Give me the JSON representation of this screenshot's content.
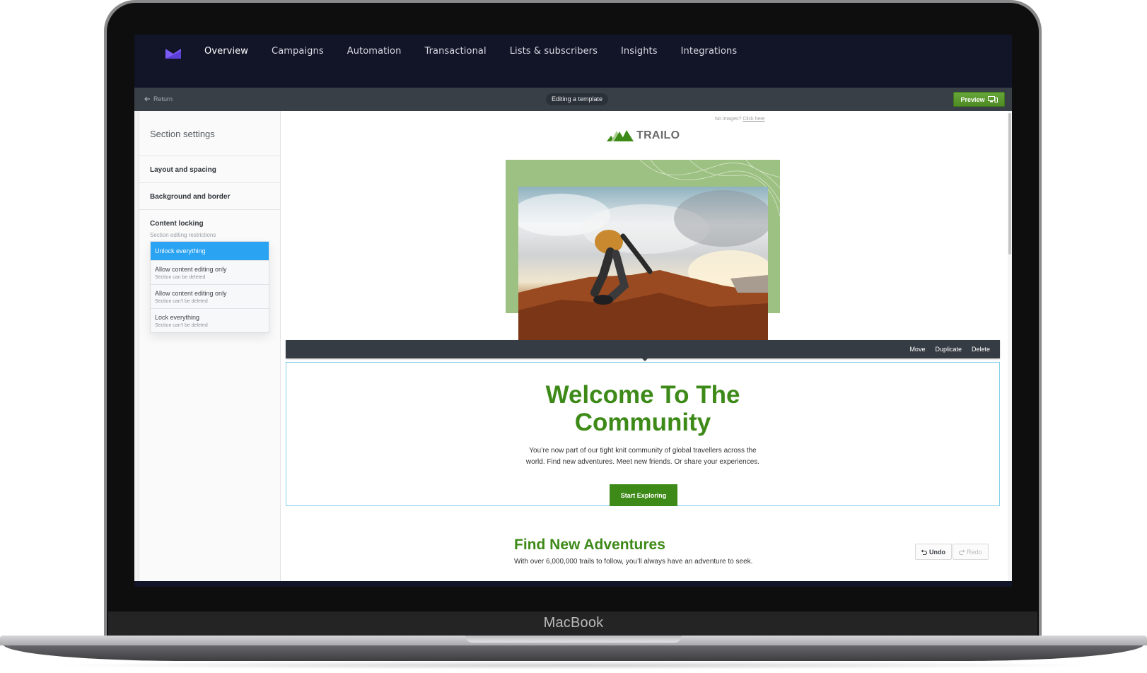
{
  "device": {
    "label": "MacBook"
  },
  "topnav": {
    "logo_icon": "envelope-logo-icon",
    "items": [
      {
        "label": "Overview",
        "active": true
      },
      {
        "label": "Campaigns",
        "active": false
      },
      {
        "label": "Automation",
        "active": false
      },
      {
        "label": "Transactional",
        "active": false
      },
      {
        "label": "Lists & subscribers",
        "active": false
      },
      {
        "label": "Insights",
        "active": false
      },
      {
        "label": "Integrations",
        "active": false
      }
    ]
  },
  "editbar": {
    "return_label": "Return",
    "return_icon": "arrow-left-icon",
    "status": "Editing a template",
    "preview_label": "Preview",
    "preview_icon": "devices-icon"
  },
  "sidebar": {
    "title": "Section settings",
    "sections": [
      {
        "label": "Layout and spacing"
      },
      {
        "label": "Background and border"
      },
      {
        "label": "Content locking"
      }
    ],
    "locking": {
      "subtitle": "Section editing restrictions",
      "options": [
        {
          "label": "Unlock everything",
          "sub": "",
          "selected": true
        },
        {
          "label": "Allow content editing only",
          "sub": "Section can be deleted",
          "selected": false
        },
        {
          "label": "Allow content editing only",
          "sub": "Section can’t be deleted",
          "selected": false
        },
        {
          "label": "Lock everything",
          "sub": "Section can’t be deleted",
          "selected": false
        }
      ]
    }
  },
  "email": {
    "no_images_text": "No images?",
    "no_images_link": "Click here",
    "brand": "TRAILO",
    "section_toolbar": {
      "move": "Move",
      "duplicate": "Duplicate",
      "delete": "Delete"
    },
    "welcome": {
      "title_line1": "Welcome To The",
      "title_line2": "Community",
      "body_line1": "You’re now part of our tight knit community of global travellers across the",
      "body_line2": "world. Find new adventures. Meet new friends. Or share your experiences.",
      "cta": "Start Exploring"
    },
    "adventures": {
      "title": "Find New Adventures",
      "body": "With over 6,000,000 trails to follow, you’ll always have an adventure to seek."
    }
  },
  "history": {
    "undo": "Undo",
    "redo": "Redo"
  },
  "colors": {
    "nav_bg": "#121427",
    "editbar_bg": "#383f47",
    "preview_green": "#5a9a2e",
    "brand_green": "#3e8a19",
    "selected_blue": "#2aa3f2",
    "logo_purple": "#7c5cf5"
  }
}
